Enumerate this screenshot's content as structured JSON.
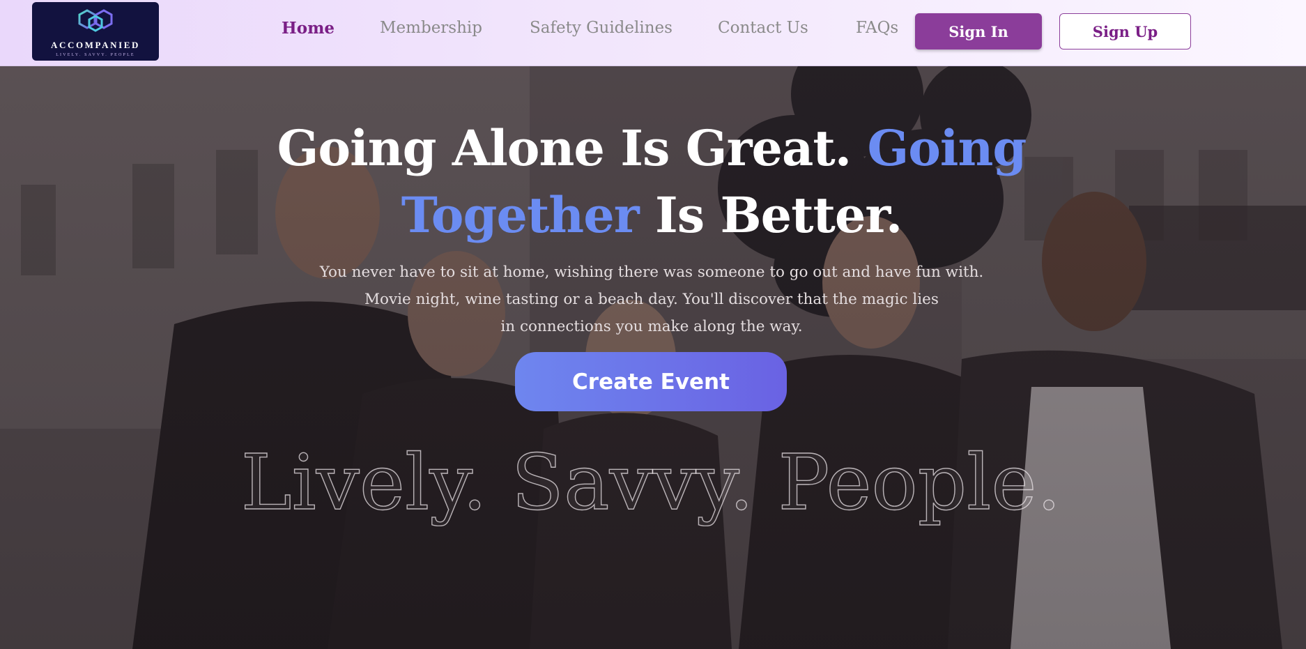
{
  "brand": {
    "name": "ACCOMPANIED",
    "tagline": "LIVELY. SAVVY. PEOPLE"
  },
  "nav": {
    "items": [
      {
        "label": "Home",
        "active": true
      },
      {
        "label": "Membership",
        "active": false
      },
      {
        "label": "Safety Guidelines",
        "active": false
      },
      {
        "label": "Contact Us",
        "active": false
      },
      {
        "label": "FAQs",
        "active": false
      }
    ],
    "signin_label": "Sign In",
    "signup_label": "Sign Up"
  },
  "hero": {
    "headline_part1": "Going Alone Is Great.",
    "headline_accent": "Going Together",
    "headline_part2": "Is Better.",
    "subtext_lines": [
      "You never have to sit at home, wishing there was someone to go out and have fun with.",
      "Movie night, wine tasting or a beach day. You'll discover that the magic lies",
      "in connections you make along the way."
    ],
    "cta_label": "Create Event",
    "watermark": "Lively. Savvy. People."
  },
  "colors": {
    "brand_purple": "#7a1f86",
    "button_purple": "#8b3d9a",
    "accent_blue": "#6b8cf2",
    "cta_gradient_start": "#6e86ef",
    "cta_gradient_end": "#6a62e3",
    "logo_bg": "#12123f"
  },
  "icons": {
    "logo_mark": "interlocking-hexagons-icon"
  }
}
